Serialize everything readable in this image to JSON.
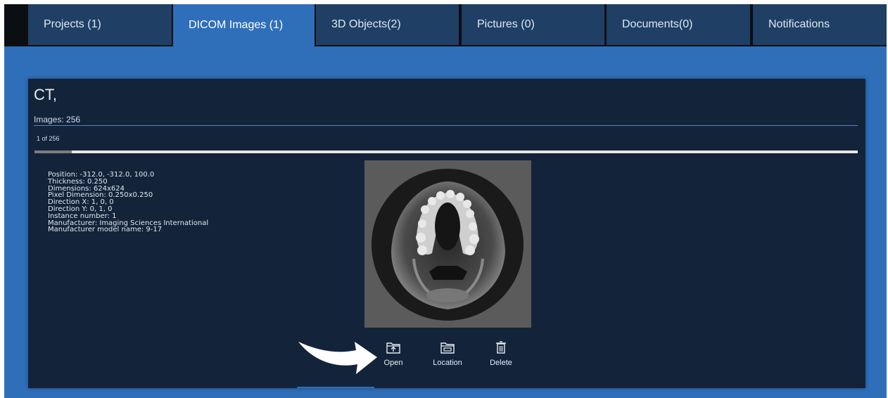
{
  "tabs": [
    {
      "label": "Projects (1)"
    },
    {
      "label": "DICOM Images (1)"
    },
    {
      "label": "3D Objects(2)"
    },
    {
      "label": "Pictures (0)"
    },
    {
      "label": "Documents(0)"
    },
    {
      "label": "Notifications"
    }
  ],
  "active_tab": "DICOM Images (1)",
  "series": {
    "title": "CT,",
    "images_label": "Images: 256",
    "slice_label": "1 of 256",
    "slice_progress": 0.045
  },
  "info": {
    "position": "Position: -312.0, -312.0, 100.0",
    "thickness": "Thickness: 0.250",
    "dimensions": "Dimensions: 624x624",
    "pixel_dimension": "Pixel Dimension: 0.250x0.250",
    "direction_x": "Direction X: 1, 0, 0",
    "direction_y": "Direction Y: 0, 1, 0",
    "instance_number": "Instance number: 1",
    "manufacturer": "Manufacturer: Imaging Sciences International",
    "manufacturer_model": "Manufacturer model name: 9-17"
  },
  "actions": {
    "open": "Open",
    "location": "Location",
    "delete": "Delete"
  },
  "icons": {
    "open": "folder-open-icon",
    "location": "folder-location-icon",
    "delete": "trash-icon",
    "arrow": "curved-arrow-icon"
  },
  "colors": {
    "accent": "#2f6fba",
    "panel": "#13233a",
    "tab": "#1f3f64",
    "tabbar": "#0b0f14"
  }
}
